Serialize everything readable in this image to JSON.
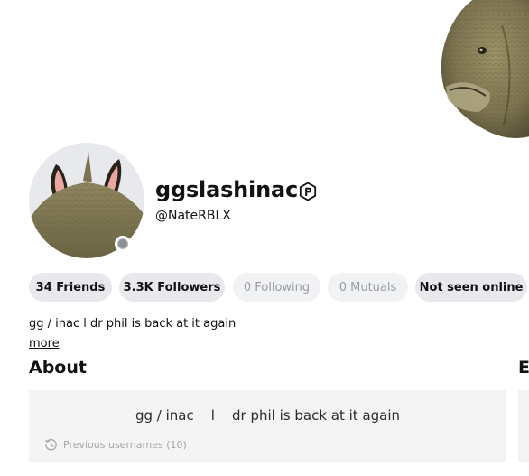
{
  "profile": {
    "display_name": "ggslashinac",
    "username": "@NateRBLX",
    "premium_icon": "premium-icon",
    "status_icon": "offline-status-dot",
    "bio_short": "gg / inac l dr phil is back at it again",
    "more_label": "more"
  },
  "stats": {
    "friends": "34 Friends",
    "followers": "3.3K Followers",
    "following": "0 Following",
    "mutuals": "0 Mutuals",
    "online_status": "Not seen online"
  },
  "about": {
    "heading": "About",
    "text": "gg / inac    l    dr phil is back at it again",
    "previous_usernames": "Previous usernames (10)",
    "previous_usernames_icon": "history-icon"
  },
  "right_panel": {
    "heading_fragment": "E"
  },
  "colors": {
    "chip_bg": "#e8e9ec",
    "chip_dim_bg": "#f1f2f4",
    "chip_dim_text": "#9a9ca2",
    "card_bg": "#f4f4f5",
    "status_offline": "#8d9096"
  }
}
